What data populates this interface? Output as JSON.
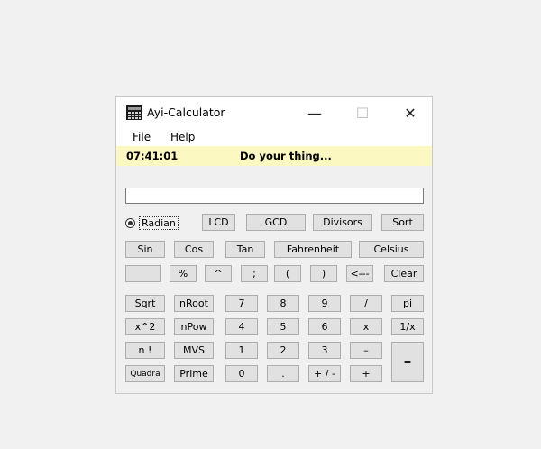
{
  "window": {
    "title": "Ayi-Calculator",
    "controls": {
      "minimize": "—",
      "maximize": "☐",
      "close": "✕"
    }
  },
  "menu": {
    "file": "File",
    "help": "Help"
  },
  "status": {
    "time": "07:41:01",
    "message": "Do your thing..."
  },
  "display": {
    "value": ""
  },
  "mode": {
    "radian_label": "Radian",
    "radian_checked": true
  },
  "buttons": {
    "lcd": "LCD",
    "gcd": "GCD",
    "divisors": "Divisors",
    "sort": "Sort",
    "sin": "Sin",
    "cos": "Cos",
    "tan": "Tan",
    "fahrenheit": "Fahrenheit",
    "celsius": "Celsius",
    "blank": "",
    "percent": "%",
    "caret": "^",
    "semicolon": ";",
    "open_paren": "(",
    "close_paren": ")",
    "backspace": "<---",
    "clear": "Clear",
    "sqrt": "Sqrt",
    "nroot": "nRoot",
    "d7": "7",
    "d8": "8",
    "d9": "9",
    "divide": "/",
    "pi": "pi",
    "square": "x^2",
    "npow": "nPow",
    "d4": "4",
    "d5": "5",
    "d6": "6",
    "multiply": "x",
    "reciprocal": "1/x",
    "factorial": "n !",
    "mvs": "MVS",
    "d1": "1",
    "d2": "2",
    "d3": "3",
    "minus": "–",
    "equals": "=",
    "quadra": "Quadra",
    "prime": "Prime",
    "d0": "0",
    "decimal": ".",
    "plus_minus": "+ / -",
    "plus": "+"
  }
}
